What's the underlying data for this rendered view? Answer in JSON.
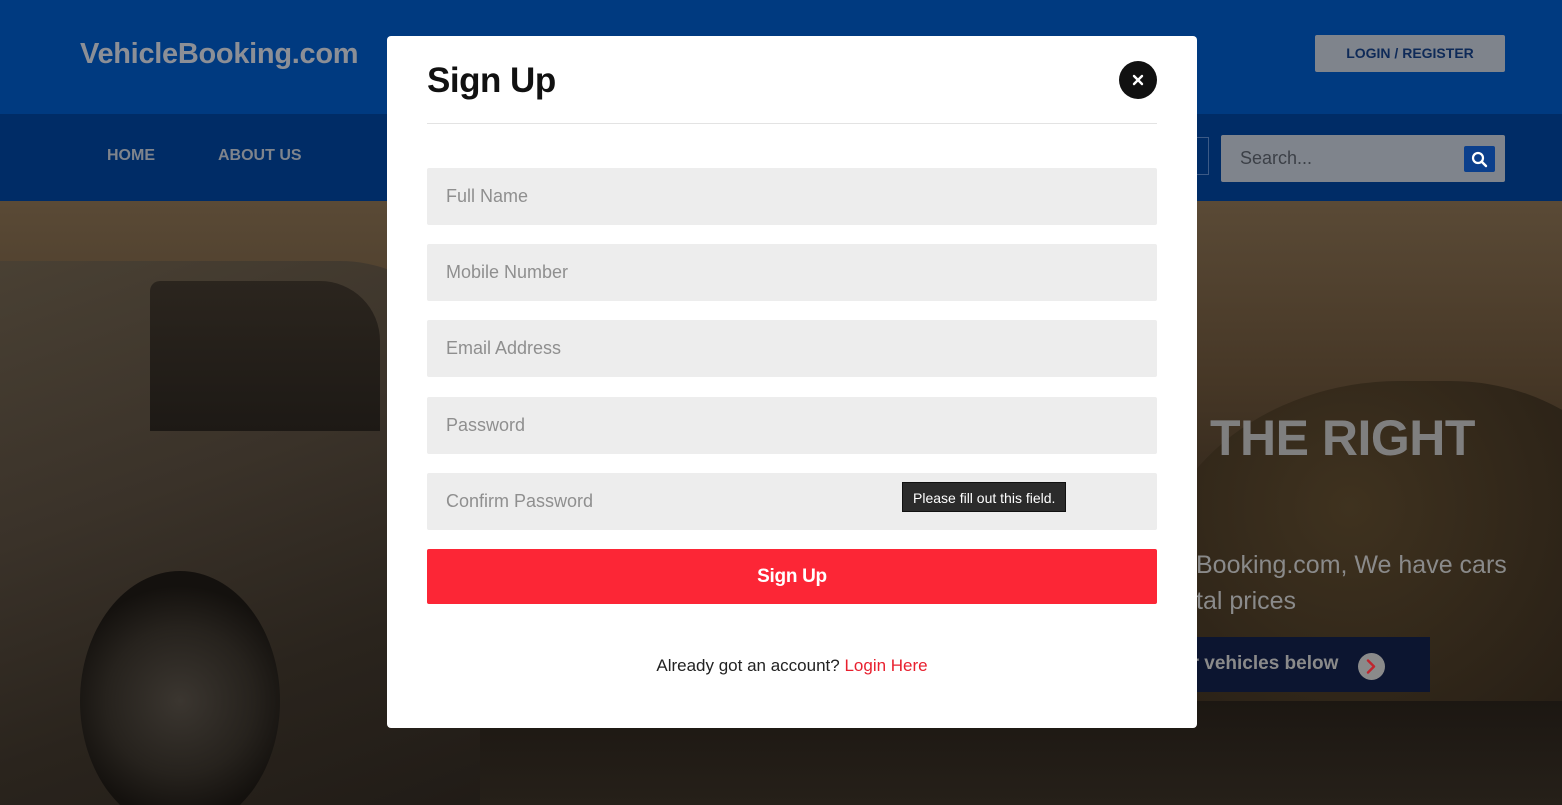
{
  "site": {
    "logo": "VehicleBooking.com",
    "login_register": "LOGIN / REGISTER"
  },
  "nav": {
    "items": [
      "HOME",
      "ABOUT US"
    ],
    "search_placeholder": "Search..."
  },
  "hero": {
    "heading": "THE RIGHT",
    "text_line_1": "Booking.com, We have cars",
    "text_line_2": "tal prices",
    "cta_label": "ur vehicles below"
  },
  "modal": {
    "title": "Sign Up",
    "fields": {
      "full_name": "Full Name",
      "mobile": "Mobile Number",
      "email": "Email Address",
      "password": "Password",
      "confirm_password": "Confirm Password"
    },
    "validation_tooltip": "Please fill out this field.",
    "submit_label": "Sign Up",
    "footer_text": "Already got an account?",
    "footer_link": "Login Here"
  },
  "colors": {
    "header_blue": "#003a80",
    "nav_blue": "#002c66",
    "primary_red": "#fc2636",
    "link_red": "#e8202f",
    "field_grey": "#ededed"
  },
  "icons": {
    "close": "close-icon",
    "search": "search-icon",
    "chevron": "chevron-right-icon"
  }
}
